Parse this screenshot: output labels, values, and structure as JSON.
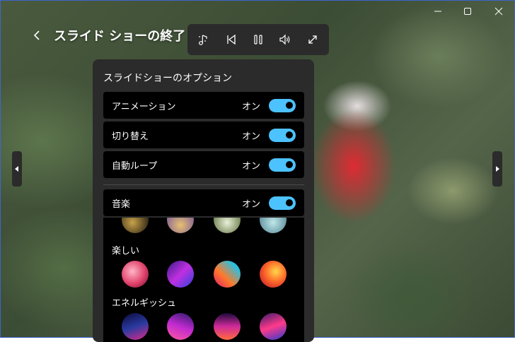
{
  "window": {
    "controls": [
      "minimize-icon",
      "maximize-icon",
      "close-icon"
    ]
  },
  "header": {
    "back_icon": "chevron-left-icon",
    "title": "スライド ショーの終了"
  },
  "toolbar": {
    "buttons": [
      "music-note-icon",
      "skip-back-icon",
      "pause-icon",
      "volume-icon",
      "expand-icon"
    ]
  },
  "nav": {
    "prev_icon": "caret-left-icon",
    "next_icon": "caret-right-icon"
  },
  "panel": {
    "title": "スライドショーのオプション",
    "options": [
      {
        "label": "アニメーション",
        "state": "オン",
        "on": true
      },
      {
        "label": "切り替え",
        "state": "オン",
        "on": true
      },
      {
        "label": "自動ループ",
        "state": "オン",
        "on": true
      }
    ],
    "music": {
      "label": "音楽",
      "state": "オン",
      "on": true
    },
    "categories": [
      {
        "label": "楽しい"
      },
      {
        "label": "エネルギッシュ"
      }
    ]
  },
  "colors": {
    "accent": "#4cc2ff",
    "panel_bg": "#2b2b2b",
    "row_bg": "#000000",
    "border": "#3b66d1"
  }
}
